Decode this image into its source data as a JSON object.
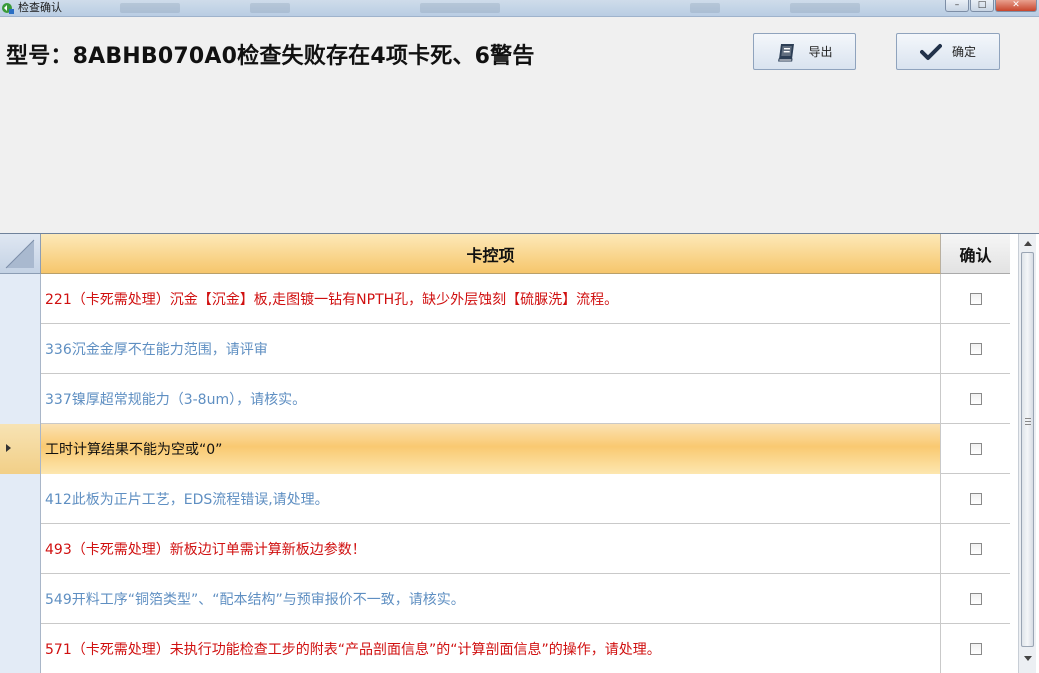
{
  "window": {
    "title": "检查确认"
  },
  "header": {
    "title": "型号：8ABHB070A0检查失败存在4项卡死、6警告",
    "export_label": "导出",
    "ok_label": "确定"
  },
  "grid": {
    "columns": {
      "item": "卡控项",
      "confirm": "确认"
    },
    "rows": [
      {
        "text": "221（卡死需处理）沉金【沉金】板,走图镀一钻有NPTH孔，缺少外层蚀刻【硫脲洗】流程。",
        "color": "#d01010",
        "checked": false
      },
      {
        "text": "336沉金金厚不在能力范围，请评审",
        "color": "#5f8fc2",
        "checked": false
      },
      {
        "text": "337镍厚超常规能力（3-8um），请核实。",
        "color": "#5f8fc2",
        "checked": false
      },
      {
        "text": "工时计算结果不能为空或“0”",
        "color": "#111111",
        "checked": false,
        "current": true
      },
      {
        "text": "412此板为正片工艺，EDS流程错误,请处理。",
        "color": "#5f8fc2",
        "checked": false
      },
      {
        "text": "493（卡死需处理）新板边订单需计算新板边参数！",
        "color": "#d01010",
        "checked": false
      },
      {
        "text": "549开料工序“铜箔类型”、“配本结构”与预审报价不一致，请核实。",
        "color": "#5f8fc2",
        "checked": false
      },
      {
        "text": "571（卡死需处理）未执行功能检查工步的附表“产品剖面信息”的“计算剖面信息”的操作，请处理。",
        "color": "#d01010",
        "checked": false
      }
    ]
  }
}
